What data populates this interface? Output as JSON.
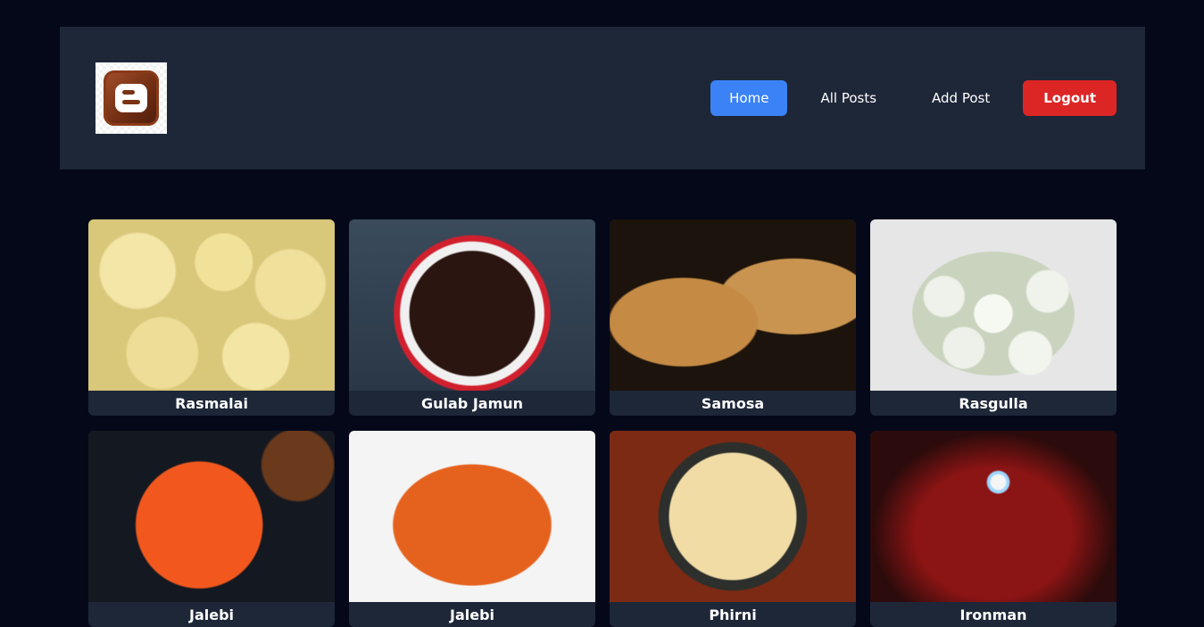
{
  "header": {
    "logo_name": "blogger-logo",
    "nav": [
      {
        "label": "Home",
        "active": true
      },
      {
        "label": "All Posts",
        "active": false
      },
      {
        "label": "Add Post",
        "active": false
      },
      {
        "label": "Logout",
        "active": false
      }
    ]
  },
  "colors": {
    "page_bg": "#040819",
    "header_bg": "#1e2738",
    "home_active": "#3b82f6",
    "logout": "#dc2626"
  },
  "posts": [
    {
      "title": "Rasmalai"
    },
    {
      "title": "Gulab Jamun"
    },
    {
      "title": "Samosa"
    },
    {
      "title": "Rasgulla"
    },
    {
      "title": "Jalebi"
    },
    {
      "title": "Jalebi"
    },
    {
      "title": "Phirni"
    },
    {
      "title": "Ironman"
    }
  ]
}
